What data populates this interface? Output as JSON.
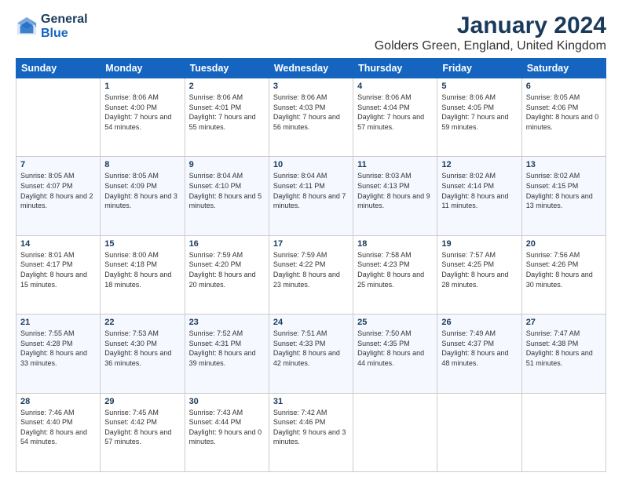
{
  "logo": {
    "line1": "General",
    "line2": "Blue"
  },
  "title": "January 2024",
  "subtitle": "Golders Green, England, United Kingdom",
  "days_of_week": [
    "Sunday",
    "Monday",
    "Tuesday",
    "Wednesday",
    "Thursday",
    "Friday",
    "Saturday"
  ],
  "weeks": [
    [
      {
        "day": "",
        "sunrise": "",
        "sunset": "",
        "daylight": "",
        "empty": true
      },
      {
        "day": "1",
        "sunrise": "Sunrise: 8:06 AM",
        "sunset": "Sunset: 4:00 PM",
        "daylight": "Daylight: 7 hours and 54 minutes."
      },
      {
        "day": "2",
        "sunrise": "Sunrise: 8:06 AM",
        "sunset": "Sunset: 4:01 PM",
        "daylight": "Daylight: 7 hours and 55 minutes."
      },
      {
        "day": "3",
        "sunrise": "Sunrise: 8:06 AM",
        "sunset": "Sunset: 4:03 PM",
        "daylight": "Daylight: 7 hours and 56 minutes."
      },
      {
        "day": "4",
        "sunrise": "Sunrise: 8:06 AM",
        "sunset": "Sunset: 4:04 PM",
        "daylight": "Daylight: 7 hours and 57 minutes."
      },
      {
        "day": "5",
        "sunrise": "Sunrise: 8:06 AM",
        "sunset": "Sunset: 4:05 PM",
        "daylight": "Daylight: 7 hours and 59 minutes."
      },
      {
        "day": "6",
        "sunrise": "Sunrise: 8:05 AM",
        "sunset": "Sunset: 4:06 PM",
        "daylight": "Daylight: 8 hours and 0 minutes."
      }
    ],
    [
      {
        "day": "7",
        "sunrise": "Sunrise: 8:05 AM",
        "sunset": "Sunset: 4:07 PM",
        "daylight": "Daylight: 8 hours and 2 minutes."
      },
      {
        "day": "8",
        "sunrise": "Sunrise: 8:05 AM",
        "sunset": "Sunset: 4:09 PM",
        "daylight": "Daylight: 8 hours and 3 minutes."
      },
      {
        "day": "9",
        "sunrise": "Sunrise: 8:04 AM",
        "sunset": "Sunset: 4:10 PM",
        "daylight": "Daylight: 8 hours and 5 minutes."
      },
      {
        "day": "10",
        "sunrise": "Sunrise: 8:04 AM",
        "sunset": "Sunset: 4:11 PM",
        "daylight": "Daylight: 8 hours and 7 minutes."
      },
      {
        "day": "11",
        "sunrise": "Sunrise: 8:03 AM",
        "sunset": "Sunset: 4:13 PM",
        "daylight": "Daylight: 8 hours and 9 minutes."
      },
      {
        "day": "12",
        "sunrise": "Sunrise: 8:02 AM",
        "sunset": "Sunset: 4:14 PM",
        "daylight": "Daylight: 8 hours and 11 minutes."
      },
      {
        "day": "13",
        "sunrise": "Sunrise: 8:02 AM",
        "sunset": "Sunset: 4:15 PM",
        "daylight": "Daylight: 8 hours and 13 minutes."
      }
    ],
    [
      {
        "day": "14",
        "sunrise": "Sunrise: 8:01 AM",
        "sunset": "Sunset: 4:17 PM",
        "daylight": "Daylight: 8 hours and 15 minutes."
      },
      {
        "day": "15",
        "sunrise": "Sunrise: 8:00 AM",
        "sunset": "Sunset: 4:18 PM",
        "daylight": "Daylight: 8 hours and 18 minutes."
      },
      {
        "day": "16",
        "sunrise": "Sunrise: 7:59 AM",
        "sunset": "Sunset: 4:20 PM",
        "daylight": "Daylight: 8 hours and 20 minutes."
      },
      {
        "day": "17",
        "sunrise": "Sunrise: 7:59 AM",
        "sunset": "Sunset: 4:22 PM",
        "daylight": "Daylight: 8 hours and 23 minutes."
      },
      {
        "day": "18",
        "sunrise": "Sunrise: 7:58 AM",
        "sunset": "Sunset: 4:23 PM",
        "daylight": "Daylight: 8 hours and 25 minutes."
      },
      {
        "day": "19",
        "sunrise": "Sunrise: 7:57 AM",
        "sunset": "Sunset: 4:25 PM",
        "daylight": "Daylight: 8 hours and 28 minutes."
      },
      {
        "day": "20",
        "sunrise": "Sunrise: 7:56 AM",
        "sunset": "Sunset: 4:26 PM",
        "daylight": "Daylight: 8 hours and 30 minutes."
      }
    ],
    [
      {
        "day": "21",
        "sunrise": "Sunrise: 7:55 AM",
        "sunset": "Sunset: 4:28 PM",
        "daylight": "Daylight: 8 hours and 33 minutes."
      },
      {
        "day": "22",
        "sunrise": "Sunrise: 7:53 AM",
        "sunset": "Sunset: 4:30 PM",
        "daylight": "Daylight: 8 hours and 36 minutes."
      },
      {
        "day": "23",
        "sunrise": "Sunrise: 7:52 AM",
        "sunset": "Sunset: 4:31 PM",
        "daylight": "Daylight: 8 hours and 39 minutes."
      },
      {
        "day": "24",
        "sunrise": "Sunrise: 7:51 AM",
        "sunset": "Sunset: 4:33 PM",
        "daylight": "Daylight: 8 hours and 42 minutes."
      },
      {
        "day": "25",
        "sunrise": "Sunrise: 7:50 AM",
        "sunset": "Sunset: 4:35 PM",
        "daylight": "Daylight: 8 hours and 44 minutes."
      },
      {
        "day": "26",
        "sunrise": "Sunrise: 7:49 AM",
        "sunset": "Sunset: 4:37 PM",
        "daylight": "Daylight: 8 hours and 48 minutes."
      },
      {
        "day": "27",
        "sunrise": "Sunrise: 7:47 AM",
        "sunset": "Sunset: 4:38 PM",
        "daylight": "Daylight: 8 hours and 51 minutes."
      }
    ],
    [
      {
        "day": "28",
        "sunrise": "Sunrise: 7:46 AM",
        "sunset": "Sunset: 4:40 PM",
        "daylight": "Daylight: 8 hours and 54 minutes."
      },
      {
        "day": "29",
        "sunrise": "Sunrise: 7:45 AM",
        "sunset": "Sunset: 4:42 PM",
        "daylight": "Daylight: 8 hours and 57 minutes."
      },
      {
        "day": "30",
        "sunrise": "Sunrise: 7:43 AM",
        "sunset": "Sunset: 4:44 PM",
        "daylight": "Daylight: 9 hours and 0 minutes."
      },
      {
        "day": "31",
        "sunrise": "Sunrise: 7:42 AM",
        "sunset": "Sunset: 4:46 PM",
        "daylight": "Daylight: 9 hours and 3 minutes."
      },
      {
        "day": "",
        "sunrise": "",
        "sunset": "",
        "daylight": "",
        "empty": true
      },
      {
        "day": "",
        "sunrise": "",
        "sunset": "",
        "daylight": "",
        "empty": true
      },
      {
        "day": "",
        "sunrise": "",
        "sunset": "",
        "daylight": "",
        "empty": true
      }
    ]
  ]
}
